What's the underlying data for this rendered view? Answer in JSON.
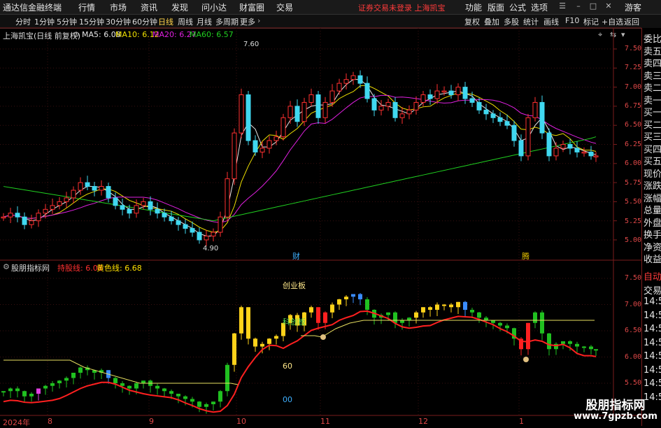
{
  "app": {
    "title": "通达信金融终端",
    "menu": [
      "行情",
      "市场",
      "资讯",
      "发现",
      "问小达",
      "财富圈",
      "交易"
    ],
    "notice": "证券交易未登录  上海凯宝",
    "right_menu": [
      "功能",
      "版面",
      "公式",
      "选项"
    ],
    "user": "游客"
  },
  "toolbar": {
    "periods": [
      "分时",
      "1分钟",
      "5分钟",
      "15分钟",
      "30分钟",
      "60分钟",
      "日线",
      "周线",
      "月线",
      "多周期",
      "更多"
    ],
    "active": "日线",
    "right_buttons": [
      "复权",
      "叠加",
      "多股",
      "统计",
      "画线",
      "F10",
      "标记",
      "+自选",
      "返回"
    ]
  },
  "main_chart": {
    "stock": "上海凯宝(日线 前复权)",
    "ma": [
      {
        "label": "MA5: 6.08",
        "color": "#e6e6e6"
      },
      {
        "label": "MA10: 6.12",
        "color": "#f0e000"
      },
      {
        "label": "MA20: 6.27",
        "color": "#e020e0"
      },
      {
        "label": "MA60: 6.57",
        "color": "#20d020"
      }
    ],
    "y_ticks": [
      "7.50",
      "7.25",
      "7.00",
      "6.75",
      "6.50",
      "6.25",
      "6.00",
      "5.75",
      "5.50",
      "5.25",
      "5.00"
    ],
    "high_label": "7.60",
    "low_label": "4.90",
    "marks": [
      "财",
      "腾"
    ]
  },
  "sub_chart": {
    "name": "股朋指标网",
    "line1": "持股线: 6.08",
    "line1_color": "#ff3030",
    "line2": "黄色线: 6.68",
    "line2_color": "#ffe000",
    "annotations": [
      "创业板",
      "科创板",
      "60",
      "00"
    ],
    "y_ticks": [
      "7.50",
      "7.00",
      "6.50",
      "6.00",
      "5.50"
    ]
  },
  "x_axis": {
    "labels": [
      "2024年",
      "8",
      "9",
      "10",
      "11",
      "12",
      "1"
    ]
  },
  "side_panel": {
    "top_labels": [
      "委比",
      "卖五",
      "卖四",
      "卖三",
      "卖二",
      "卖一",
      "买一",
      "买二",
      "买三",
      "买四",
      "买五",
      "现价",
      "涨跌",
      "涨幅",
      "总量",
      "外盘",
      "换手",
      "净资",
      "收益"
    ],
    "bottom_labels": [
      "自动",
      "交易",
      "14:56",
      "14:56",
      "14:56",
      "14:56",
      "14:56",
      "14:56",
      "14:56",
      "14:56"
    ]
  },
  "watermark": {
    "text": "股朋指标网",
    "url": "www.7gpzb.com"
  }
}
